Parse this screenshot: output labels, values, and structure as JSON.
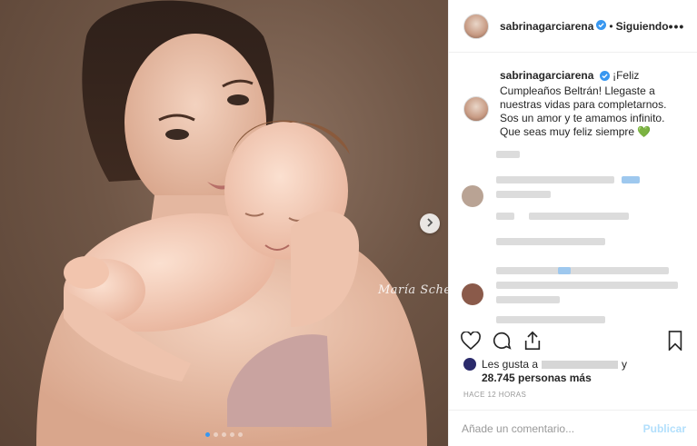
{
  "post": {
    "watermark": "María Schef",
    "carousel_count": 5,
    "carousel_active_index": 0
  },
  "header": {
    "username": "sabrinagarciarena",
    "separator": "•",
    "follow_status": "Siguiendo",
    "more_label": "•••"
  },
  "caption": {
    "username": "sabrinagarciarena",
    "text": "¡Feliz Cumpleaños Beltrán! Llegaste a nuestras vidas para completarnos. Sos un amor y te amamos infinito. Que seas muy feliz siempre",
    "emoji": "💚"
  },
  "likes": {
    "prefix": "Les gusta a",
    "connector": "y",
    "count": "28.745 personas más"
  },
  "timestamp": "HACE 12 HORAS",
  "comment": {
    "placeholder": "Añade un comentario...",
    "publish_label": "Publicar"
  },
  "colors": {
    "accent": "#3897f0",
    "verified": "#3897f0",
    "publish_disabled": "#b2dffc",
    "heart_emoji": "#1fc1b7"
  },
  "icons": [
    "heart-icon",
    "comment-icon",
    "share-icon",
    "bookmark-icon",
    "chevron-right-icon",
    "verified-icon"
  ]
}
